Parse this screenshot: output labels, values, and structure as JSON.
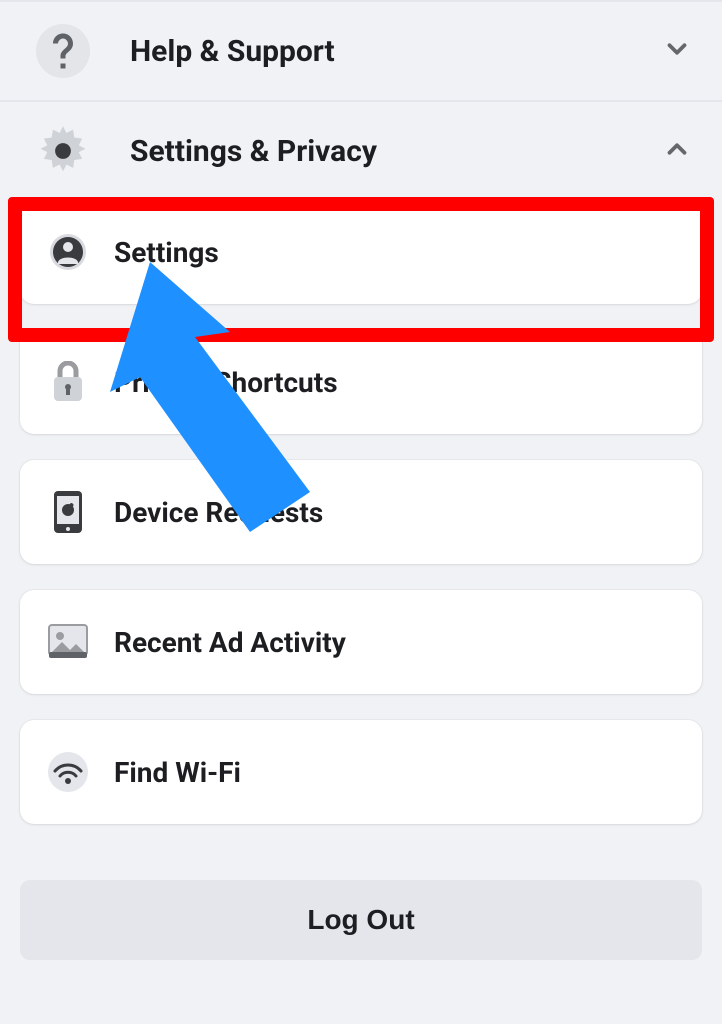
{
  "sections": {
    "help": {
      "label": "Help & Support",
      "expanded": false
    },
    "settings_privacy": {
      "label": "Settings & Privacy",
      "expanded": true
    }
  },
  "settings_items": {
    "settings": "Settings",
    "privacy_shortcuts": "Privacy Shortcuts",
    "device_requests": "Device Requests",
    "recent_ad_activity": "Recent Ad Activity",
    "find_wifi": "Find Wi-Fi"
  },
  "logout": "Log Out",
  "annotation": {
    "highlight_color": "#ff0000",
    "arrow_color": "#1e90ff"
  }
}
